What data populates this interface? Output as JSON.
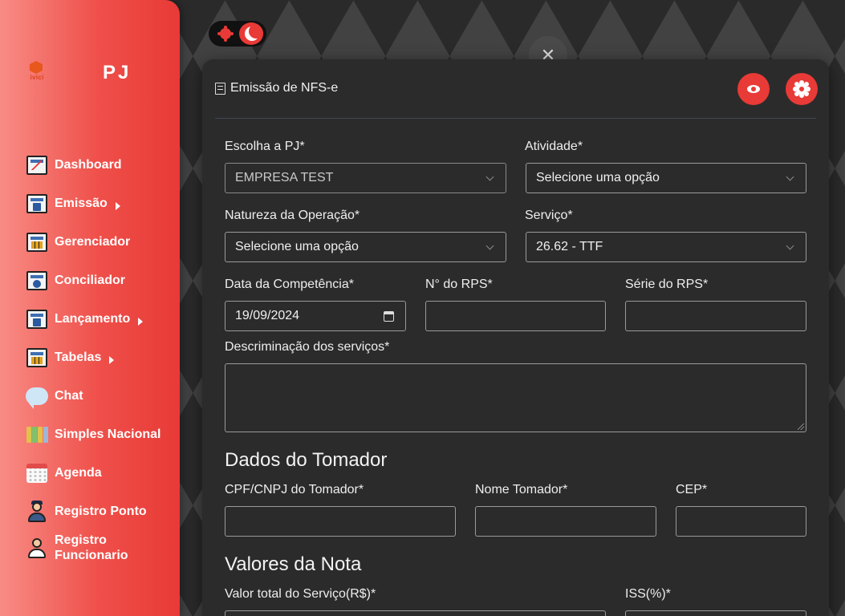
{
  "brand": {
    "logo_text": "ivici",
    "title": "PJ"
  },
  "sidebar": {
    "items": [
      {
        "label": "Dashboard",
        "icon": "chart-board-icon",
        "has_submenu": false
      },
      {
        "label": "Emissão",
        "icon": "document-window-icon",
        "has_submenu": true
      },
      {
        "label": "Gerenciador",
        "icon": "table-window-icon",
        "has_submenu": false
      },
      {
        "label": "Conciliador",
        "icon": "search-document-icon",
        "has_submenu": false
      },
      {
        "label": "Lançamento",
        "icon": "document-window-icon",
        "has_submenu": true
      },
      {
        "label": "Tabelas",
        "icon": "table-window-icon",
        "has_submenu": true
      },
      {
        "label": "Chat",
        "icon": "chat-bubble-icon",
        "has_submenu": false
      },
      {
        "label": "Simples Nacional",
        "icon": "books-icon",
        "has_submenu": false
      },
      {
        "label": "Agenda",
        "icon": "calendar-icon",
        "has_submenu": false
      },
      {
        "label": "Registro Ponto",
        "icon": "worker-clock-icon",
        "has_submenu": false
      },
      {
        "label_line1": "Registro",
        "label_line2": "Funcionario",
        "icon": "employee-icon",
        "has_submenu": false
      }
    ]
  },
  "theme_toggle": {
    "mode": "dark"
  },
  "modal": {
    "title": "Emissão de NFS-e",
    "fields": {
      "pj": {
        "label": "Escolha a PJ*",
        "value": "EMPRESA TEST"
      },
      "atividade": {
        "label": "Atividade*",
        "value": "Selecione uma opção"
      },
      "natureza": {
        "label": "Natureza da Operação*",
        "value": "Selecione uma opção"
      },
      "servico": {
        "label": "Serviço*",
        "value": "26.62 - TTF"
      },
      "competencia": {
        "label": "Data da Competência*",
        "value": "19/09/2024"
      },
      "rps_num": {
        "label": "N° do RPS*",
        "value": ""
      },
      "rps_serie": {
        "label": "Série do RPS*",
        "value": ""
      },
      "descricao": {
        "label": "Descriminação dos serviços*",
        "value": ""
      }
    },
    "tomador": {
      "title": "Dados do Tomador",
      "cpf_cnpj_label": "CPF/CNPJ do Tomador*",
      "nome_label": "Nome Tomador*",
      "cep_label": "CEP*"
    },
    "valores": {
      "title": "Valores da Nota",
      "valor_total_label": "Valor total do Serviço(R$)*",
      "iss_label": "ISS(%)*"
    }
  },
  "colors": {
    "accent": "#e83a36",
    "sidebar_light": "#f88c85",
    "modal_bg": "#2b2b2b"
  }
}
